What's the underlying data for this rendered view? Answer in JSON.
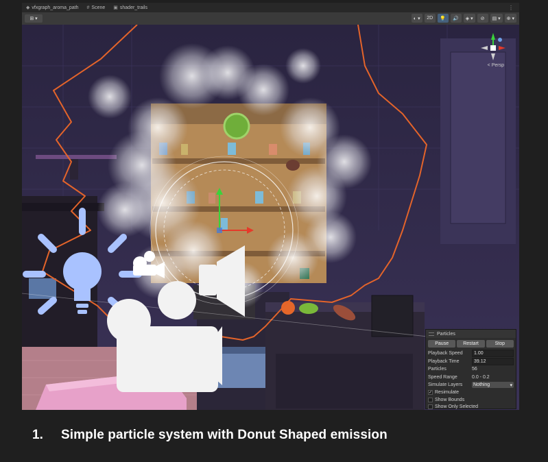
{
  "tabs": [
    {
      "label": "vfxgraph_aroma_path",
      "icon": "unity-icon"
    },
    {
      "label": "Scene",
      "icon": "grid-icon"
    },
    {
      "label": "shader_trails",
      "icon": "scene-icon"
    }
  ],
  "toolbar": {
    "left_button": "⊞ ▾",
    "buttons": [
      "◐ ▾",
      "2D",
      "💡",
      "🔊",
      "◈ ▾",
      "⊘",
      "▤ ▾",
      "⊕ ▾"
    ],
    "active_index": 2
  },
  "gizmo": {
    "projection": "< Persp"
  },
  "particles_panel": {
    "title": "Particles",
    "buttons": [
      "Pause",
      "Restart",
      "Stop"
    ],
    "playback_speed_label": "Playback Speed",
    "playback_speed": "1.00",
    "playback_time_label": "Playback Time",
    "playback_time": "39.12",
    "particles_label": "Particles",
    "particles": "56",
    "speed_range_label": "Speed Range",
    "speed_range": "0.0 - 0.2",
    "simulate_layers_label": "Simulate Layers",
    "simulate_layers": "Nothing",
    "checkboxes": [
      {
        "label": "Resimulate",
        "checked": true
      },
      {
        "label": "Show Bounds",
        "checked": false
      },
      {
        "label": "Show Only Selected",
        "checked": false
      }
    ]
  },
  "caption": {
    "number": "1.",
    "text": "Simple particle system with Donut Shaped emission"
  },
  "colors": {
    "trail": "#e4642a",
    "wall": "#302a47",
    "counter_pink": "#e7a1c9",
    "light_icon": "#a9c2ff",
    "toolbar_active": "#46607c"
  }
}
